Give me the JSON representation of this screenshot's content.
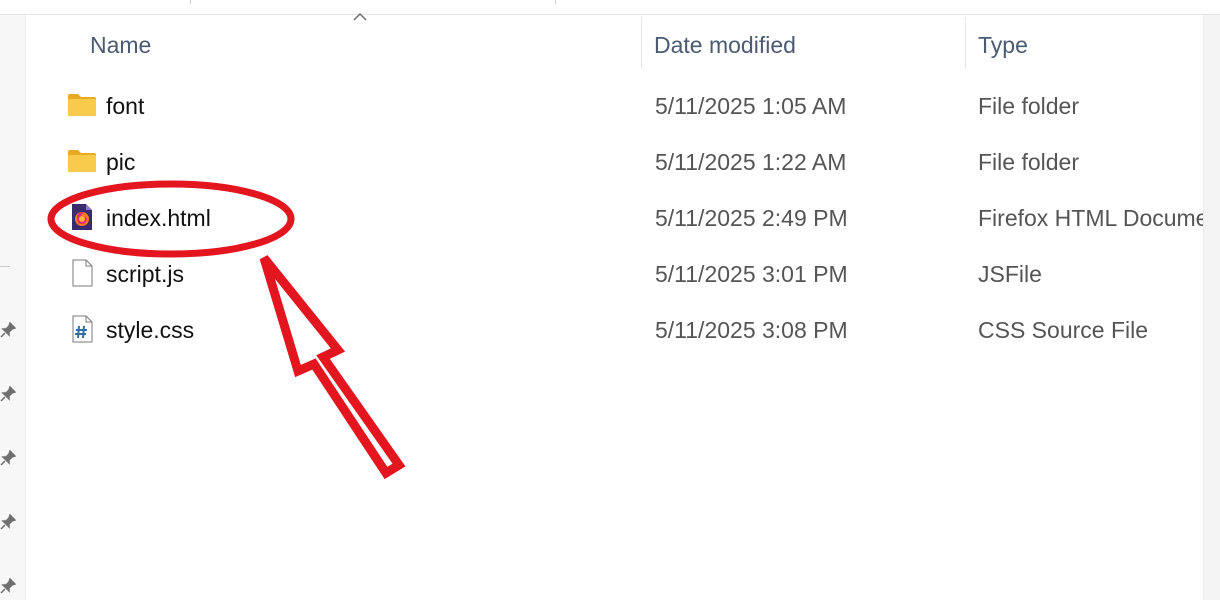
{
  "columns": {
    "name": "Name",
    "date_modified": "Date modified",
    "type": "Type"
  },
  "files": [
    {
      "name": "font",
      "date": "5/11/2025 1:05 AM",
      "type": "File folder",
      "icon": "folder-icon"
    },
    {
      "name": "pic",
      "date": "5/11/2025 1:22 AM",
      "type": "File folder",
      "icon": "folder-icon"
    },
    {
      "name": "index.html",
      "date": "5/11/2025 2:49 PM",
      "type": "Firefox HTML Document",
      "icon": "firefox-html-icon"
    },
    {
      "name": "script.js",
      "date": "5/11/2025 3:01 PM",
      "type": "JSFile",
      "icon": "blank-file-icon"
    },
    {
      "name": "style.css",
      "date": "5/11/2025 3:08 PM",
      "type": "CSS Source File",
      "icon": "css-file-icon"
    }
  ],
  "annotation": {
    "highlighted_item": "index.html",
    "color": "#e3151f"
  },
  "colors": {
    "header_text": "#4b5b72",
    "folder": "#f4c542"
  }
}
